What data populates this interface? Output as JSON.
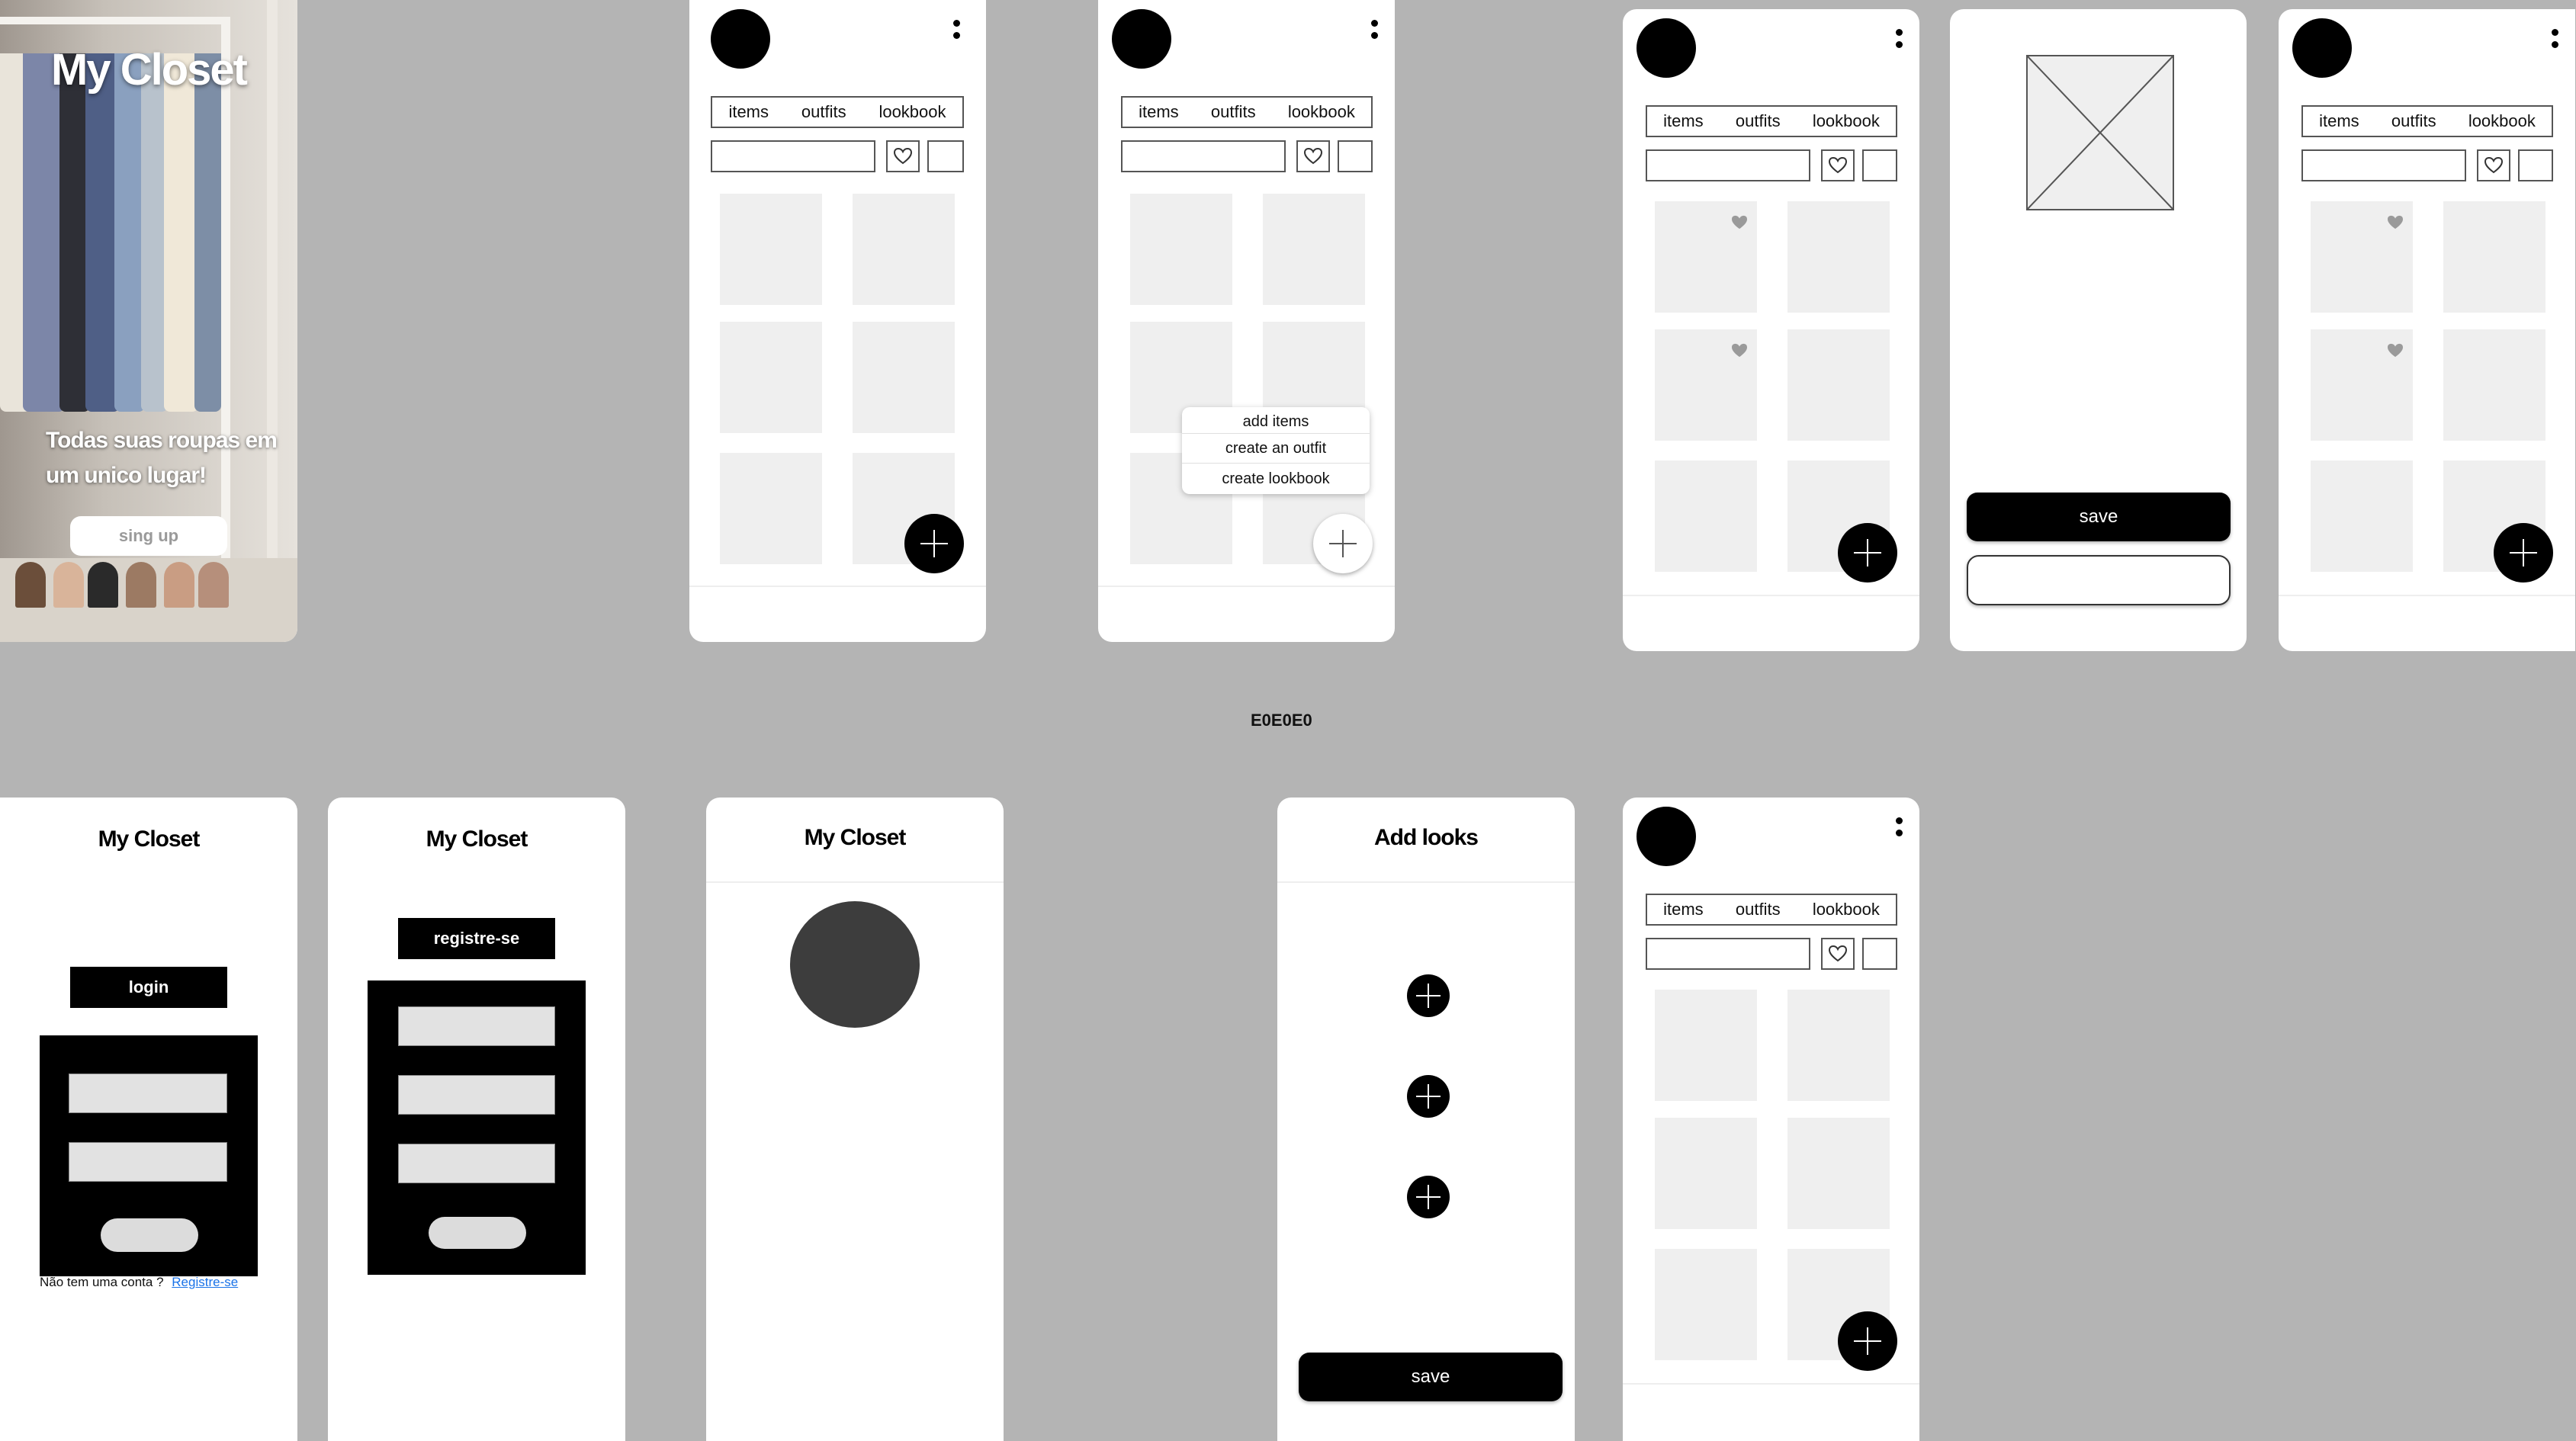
{
  "canvas": {
    "label": "E0E0E0",
    "background": "#b4b4b4"
  },
  "welcome": {
    "title": "My Closet",
    "tagline": "Todas suas roupas em um unico lugar!",
    "signup_label": "sing up"
  },
  "nav": {
    "tabs": [
      "items",
      "outfits",
      "lookbook"
    ]
  },
  "add_menu": {
    "items": [
      "add items",
      "create an outfit",
      "create  lookbook"
    ]
  },
  "detail": {
    "save_label": "save"
  },
  "login": {
    "title": "My Closet",
    "login_label": "login",
    "no_account": "Não tem uma conta ?",
    "register_link": "Registre-se"
  },
  "register": {
    "title": "My Closet",
    "register_label": "registre-se"
  },
  "profile": {
    "title": "My Closet"
  },
  "add_looks": {
    "title": "Add looks",
    "save_label": "save"
  },
  "colors": {
    "accent": "#000000",
    "tile": "#efefef",
    "link": "#1a73e8",
    "profile_circle": "#3d3d3d"
  }
}
